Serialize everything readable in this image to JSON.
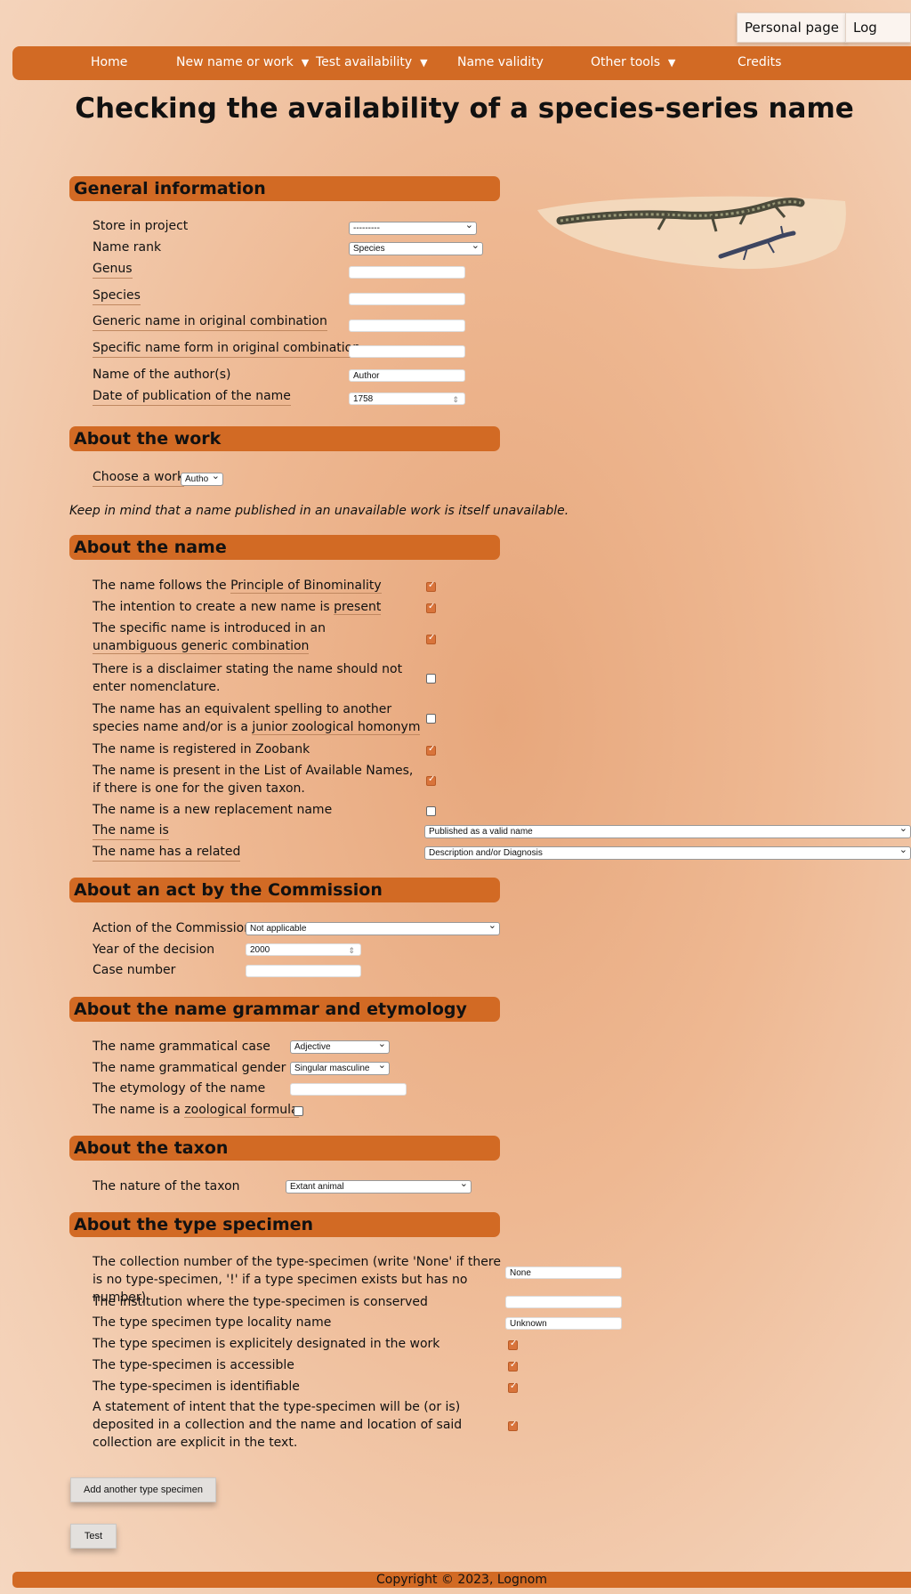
{
  "top": {
    "personal_page": "Personal page",
    "log_out": "Log out"
  },
  "nav": {
    "home": "Home",
    "new_name": "New name or work",
    "test_availability": "Test availability",
    "name_validity": "Name validity",
    "other_tools": "Other tools",
    "credits": "Credits",
    "arrow": "▼"
  },
  "page_title": "Checking the availability of a species-series name",
  "general": {
    "title": "General information",
    "store_label": "Store in project",
    "store_value": "---------",
    "rank_label": "Name rank",
    "rank_value": "Species",
    "genus_label": "Genus",
    "species_label": "Species",
    "generic_orig_label": "Generic name in original combination",
    "specific_orig_label": "Specific name form in original combination",
    "author_label": "Name of the author(s)",
    "author_value": "Author",
    "date_label": "Date of publication of the name",
    "date_value": "1758"
  },
  "work": {
    "title": "About the work",
    "choose_label": "Choose a work",
    "choose_value": "Autho",
    "note": "Keep in mind that a name published in an unavailable work is itself unavailable."
  },
  "name": {
    "title": "About the name",
    "binom_pre": "The name follows the ",
    "binom_link": "Principle of Binominality",
    "intent_pre": "The intention to create a new name is ",
    "intent_link": "present",
    "specific_pre": "The specific name is introduced in an",
    "specific_link": "unambiguous generic combination",
    "disclaimer": "There is a disclaimer stating the name should not enter nomenclature.",
    "equiv_pre": "The name has an equivalent spelling to another species name and/or is a ",
    "equiv_link": "junior zoological homonym",
    "zoobank": "The name is registered in Zoobank",
    "list_avail": "The name is present in the List of Available Names, if there is one for the given taxon.",
    "replacement": "The name is a new replacement name",
    "name_is_label": "The name is",
    "name_is_value": "Published as a valid name",
    "related_label": "The name has a related",
    "related_value": "Description and/or Diagnosis",
    "checks": [
      true,
      true,
      true,
      false,
      false,
      true,
      true,
      false
    ]
  },
  "commission": {
    "title": "About an act by the Commission",
    "action_label": "Action of the Commission",
    "action_value": "Not applicable",
    "year_label": "Year of the decision",
    "year_value": "2000",
    "case_label": "Case number"
  },
  "grammar": {
    "title": "About the name grammar and etymology",
    "case_label": "The name grammatical case",
    "case_value": "Adjective",
    "gender_label": "The name grammatical gender",
    "gender_value": "Singular masculine",
    "etym_label": "The etymology of the name",
    "formula_pre": "The name is a ",
    "formula_link": "zoological formula"
  },
  "taxon": {
    "title": "About the taxon",
    "nature_label": "The nature of the taxon",
    "nature_value": "Extant animal"
  },
  "type": {
    "title": "About the type specimen",
    "collection_label": "The collection number of the type-specimen (write 'None' if there is no type-specimen, '!' if a type specimen exists but has no number)",
    "collection_value": "None",
    "institution_label": "The institution where the type-specimen is conserved",
    "locality_label": "The type specimen type locality name",
    "locality_value": "Unknown",
    "designated_label": "The type specimen is explicitely designated in the work",
    "accessible_label": "The type-specimen is accessible",
    "identifiable_label": "The type-specimen is identifiable",
    "statement_label": "A statement of intent that the type-specimen will be (or is) deposited in a collection and the name and location of said collection are explicit in the text."
  },
  "buttons": {
    "add_type": "Add another type specimen",
    "test": "Test"
  },
  "footer": "Copyright © 2023, Lognom",
  "colors": {
    "accent": "#d26a24",
    "checkbox": "#d9743b"
  }
}
